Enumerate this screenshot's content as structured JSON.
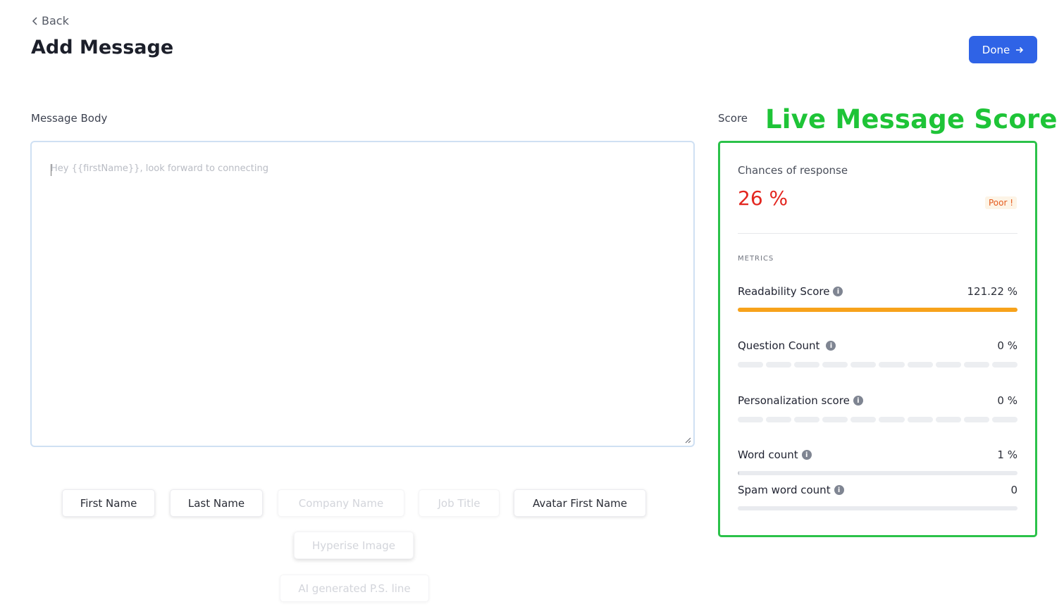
{
  "header": {
    "back_label": "Back",
    "title": "Add Message",
    "done_label": "Done"
  },
  "editor": {
    "section_label": "Message Body",
    "placeholder": "Hey {{firstName}}, look forward to connecting"
  },
  "variables": [
    {
      "label": "First Name",
      "enabled": true
    },
    {
      "label": "Last Name",
      "enabled": true
    },
    {
      "label": "Company Name",
      "enabled": false
    },
    {
      "label": "Job Title",
      "enabled": false
    },
    {
      "label": "Avatar First Name",
      "enabled": true
    },
    {
      "label": "Hyperise Image",
      "enabled": false
    },
    {
      "label": "AI generated P.S. line",
      "enabled": false
    }
  ],
  "score": {
    "section_label": "Score",
    "banner": "Live Message Score",
    "chances_label": "Chances of response",
    "chances_value": "26 %",
    "rating": "Poor !",
    "metrics_title": "METRICS",
    "metrics": [
      {
        "name": "Readability Score",
        "value": "121.22 %",
        "fill": 1.0
      },
      {
        "name": "Question Count",
        "value": "0 %",
        "fill": 0.0
      },
      {
        "name": "Personalization score",
        "value": "0 %",
        "fill": 0.0
      },
      {
        "name": "Word count",
        "value": "1 %",
        "fill": 0.01
      },
      {
        "name": "Spam word count",
        "value": "0",
        "fill": 0.0
      }
    ]
  },
  "colors": {
    "primary": "#2f63e6",
    "score_banner": "#1ec437",
    "card_border": "#2bc24a",
    "poor": "#e3261f",
    "readability_bar": "#f7a21b"
  }
}
